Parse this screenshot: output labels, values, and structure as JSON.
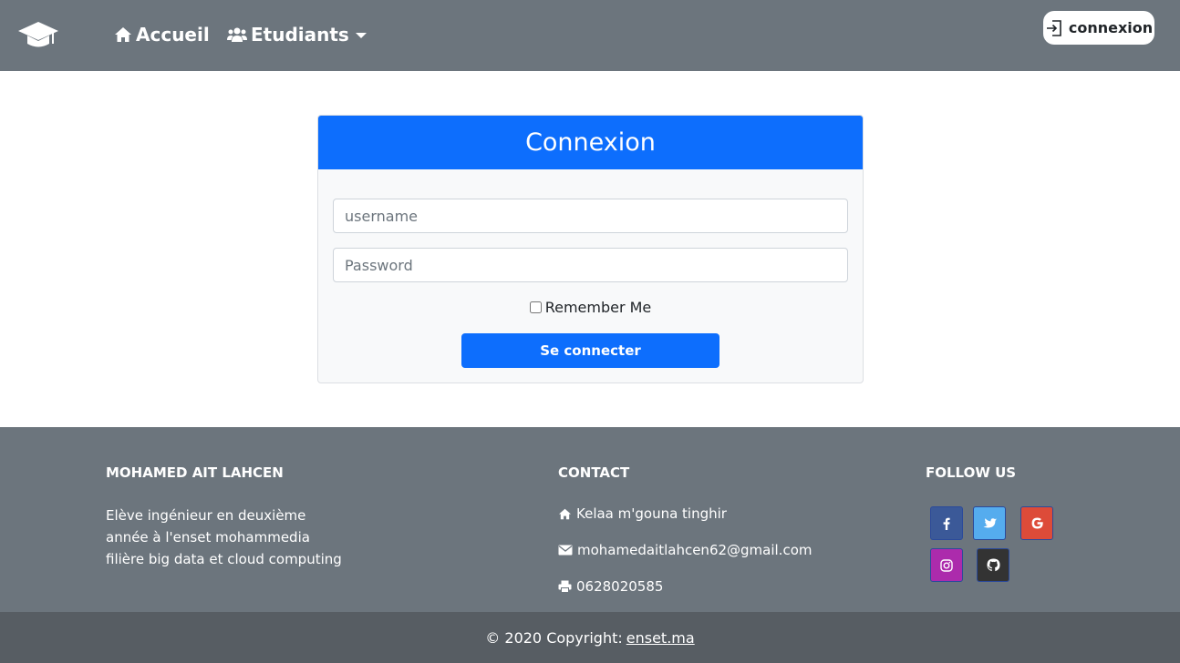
{
  "nav": {
    "brand_icon": "graduation-cap-icon",
    "home_label": "Accueil",
    "students_label": "Etudiants",
    "login_label": "connexion"
  },
  "login_card": {
    "title": "Connexion",
    "username_placeholder": "username",
    "password_placeholder": "Password",
    "remember_label": "Remember Me",
    "submit_label": "Se connecter"
  },
  "footer": {
    "about": {
      "title": "MOHAMED AIT LAHCEN",
      "lines": [
        "Elève ingénieur en deuxième",
        "année à l'enset mohammedia",
        "filière big data et cloud computing"
      ]
    },
    "contact": {
      "title": "CONTACT",
      "address": "Kelaa m'gouna tinghir",
      "email": "mohamedaitlahcen62@gmail.com",
      "phone": "0628020585"
    },
    "follow": {
      "title": "FOLLOW US",
      "networks": [
        "facebook-icon",
        "twitter-icon",
        "google-icon",
        "instagram-icon",
        "github-icon"
      ]
    }
  },
  "copyright": {
    "text": "© 2020 Copyright:",
    "link": "enset.ma"
  },
  "colors": {
    "navbar": "#6c757d",
    "primary": "#0d6efd",
    "copyright_bar": "#575d63"
  }
}
